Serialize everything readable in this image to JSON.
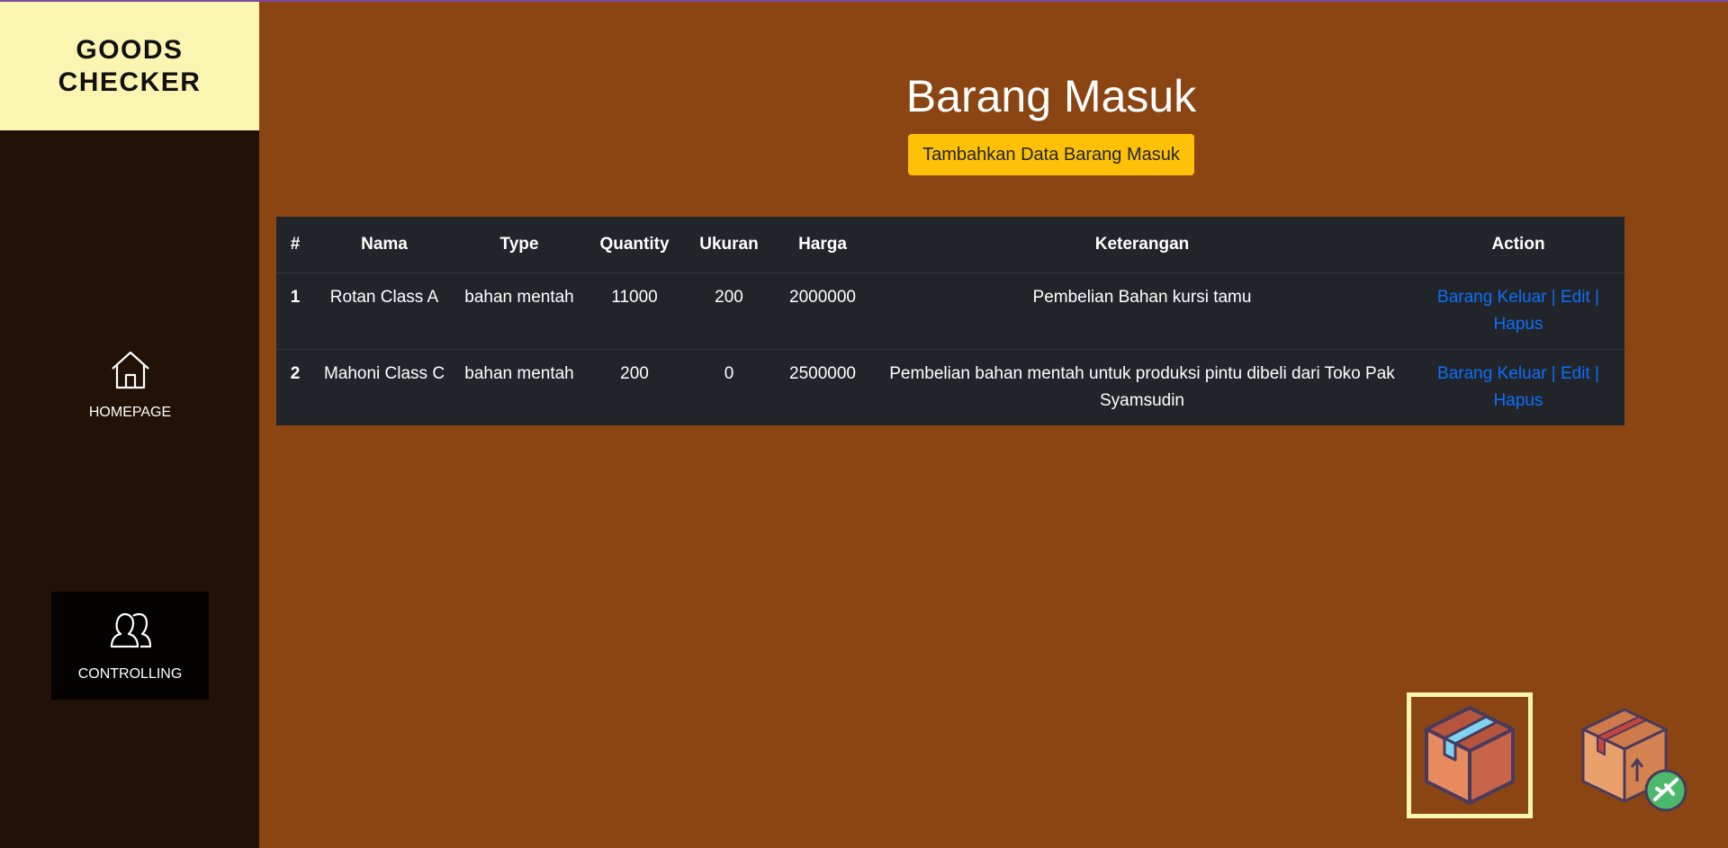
{
  "sidebar": {
    "brand_line1": "GOODS",
    "brand_line2": "CHECKER",
    "items": [
      {
        "label": "HOMEPAGE",
        "icon": "home-icon"
      },
      {
        "label": "CONTROLLING",
        "icon": "users-icon"
      }
    ]
  },
  "main": {
    "title": "Barang Masuk",
    "add_button": "Tambahkan Data Barang Masuk",
    "table": {
      "headers": [
        "#",
        "Nama",
        "Type",
        "Quantity",
        "Ukuran",
        "Harga",
        "Keterangan",
        "Action"
      ],
      "rows": [
        {
          "no": "1",
          "nama": "Rotan Class A",
          "type": "bahan mentah",
          "quantity": "11000",
          "ukuran": "200",
          "harga": "2000000",
          "keterangan": "Pembelian Bahan kursi tamu",
          "action_keluar": "Barang Keluar",
          "action_edit": "Edit",
          "action_hapus": "Hapus"
        },
        {
          "no": "2",
          "nama": "Mahoni Class C",
          "type": "bahan mentah",
          "quantity": "200",
          "ukuran": "0",
          "harga": "2500000",
          "keterangan": "Pembelian bahan mentah untuk produksi pintu dibeli dari Toko Pak Syamsudin",
          "action_keluar": "Barang Keluar",
          "action_edit": "Edit",
          "action_hapus": "Hapus"
        }
      ]
    }
  },
  "bottom_icons": [
    {
      "icon": "box-in-icon",
      "selected": true
    },
    {
      "icon": "box-out-icon",
      "selected": false
    }
  ],
  "colors": {
    "main_bg": "#8b4513",
    "sidebar_bg": "#211107",
    "brand_bg": "#fbf5b2",
    "button_bg": "#ffc107",
    "table_bg": "#212529",
    "link": "#0d6efd"
  }
}
